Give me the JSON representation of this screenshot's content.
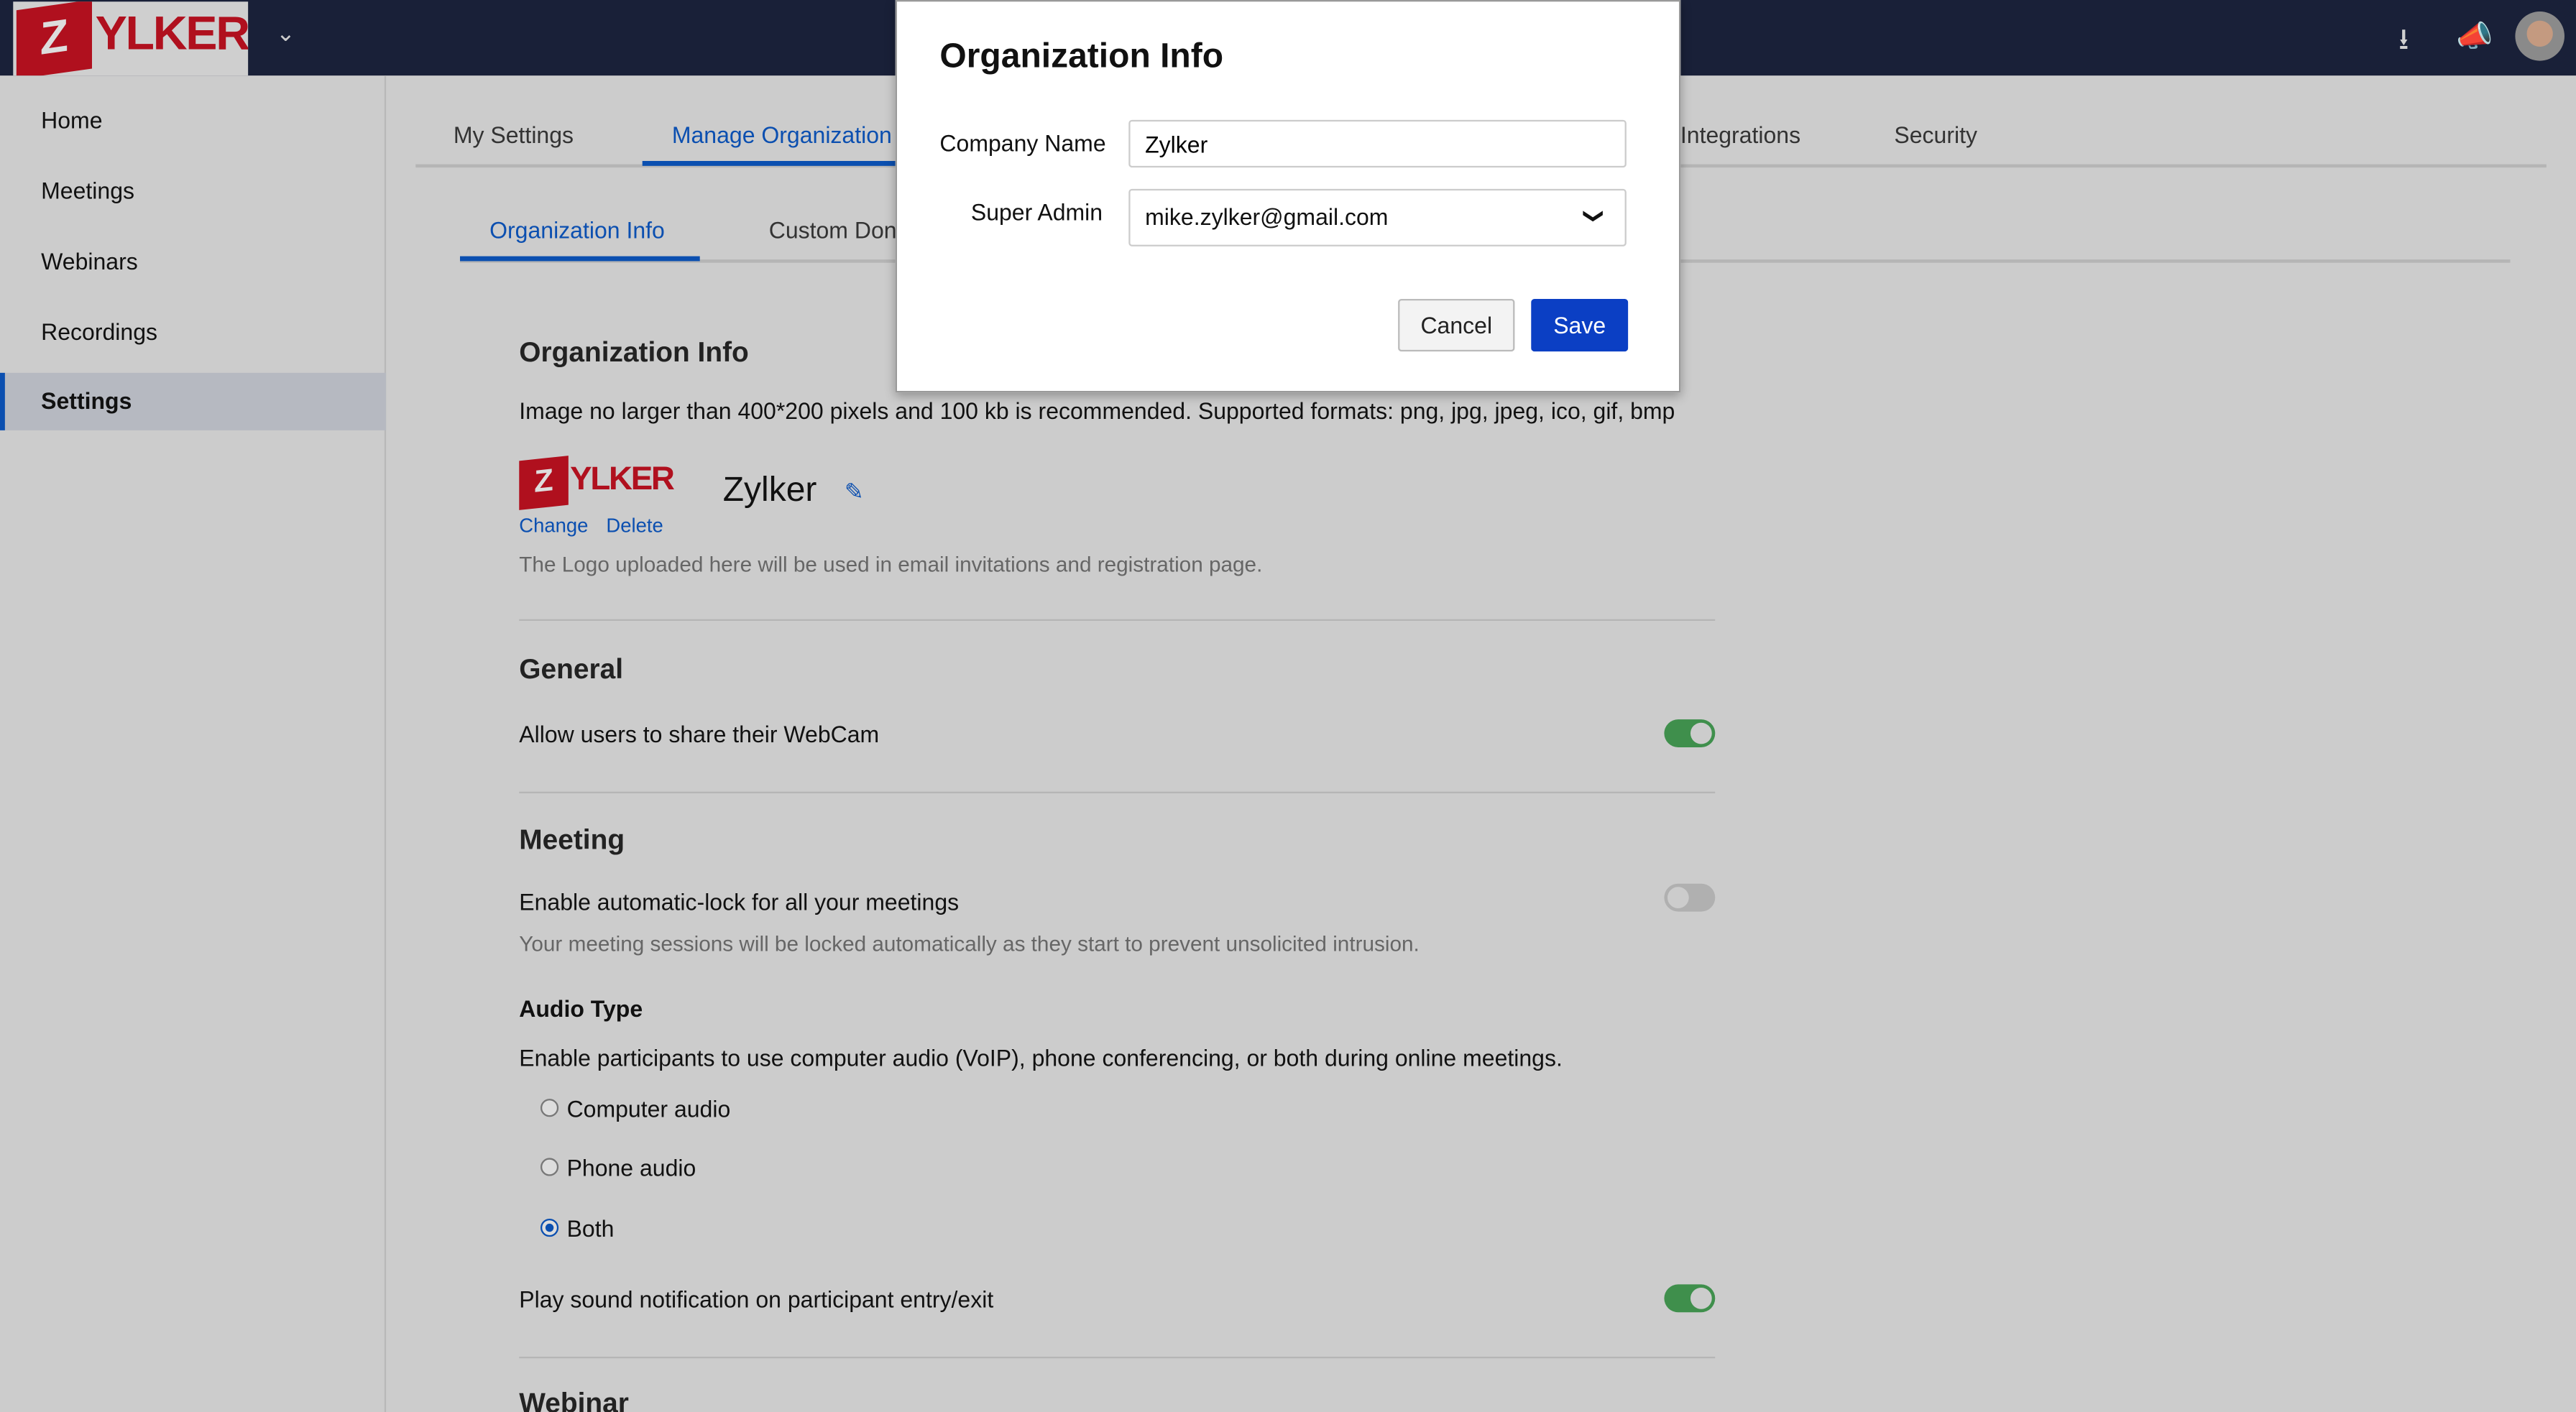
{
  "header": {
    "logo_text": "ZYLKER",
    "icons": [
      "download-icon",
      "megaphone-icon",
      "avatar"
    ]
  },
  "sidebar": {
    "items": [
      {
        "label": "Home"
      },
      {
        "label": "Meetings"
      },
      {
        "label": "Webinars"
      },
      {
        "label": "Recordings"
      },
      {
        "label": "Settings",
        "active": true
      }
    ]
  },
  "tabs": [
    {
      "label": "My Settings"
    },
    {
      "label": "Manage Organization",
      "active": true
    },
    {
      "label": "Integrations"
    },
    {
      "label": "Security"
    }
  ],
  "subtabs": [
    {
      "label": "Organization Info",
      "active": true
    },
    {
      "label": "Custom Don"
    }
  ],
  "org": {
    "title": "Organization Info",
    "image_hint": "Image no larger than 400*200 pixels and 100 kb is recommended. Supported formats: png, jpg, jpeg, ico, gif, bmp",
    "logo_text": "ZYLKER",
    "change": "Change",
    "delete": "Delete",
    "company": "Zylker",
    "logo_note": "The Logo uploaded here will be used in email invitations and registration page."
  },
  "general": {
    "title": "General",
    "webcam": "Allow users to share their WebCam",
    "webcam_on": true
  },
  "meeting": {
    "title": "Meeting",
    "autolock": "Enable automatic-lock for all your meetings",
    "autolock_on": false,
    "autolock_desc": "Your meeting sessions will be locked automatically as they start to prevent unsolicited intrusion.",
    "audio_title": "Audio Type",
    "audio_desc": "Enable participants to use computer audio (VoIP), phone conferencing, or both during online meetings.",
    "options": [
      "Computer audio",
      "Phone audio",
      "Both"
    ],
    "selected": "Both",
    "sound": "Play sound notification on participant entry/exit",
    "sound_on": true
  },
  "webinar": {
    "title": "Webinar"
  },
  "modal": {
    "title": "Organization Info",
    "company_label": "Company Name",
    "company_value": "Zylker",
    "admin_label": "Super Admin",
    "admin_value": "mike.zylker@gmail.com",
    "cancel": "Cancel",
    "save": "Save"
  },
  "colors": {
    "accent": "#0b4fb0",
    "topbar": "#192038",
    "toggle_on": "#3f8f4c",
    "brand": "#b0101e"
  }
}
